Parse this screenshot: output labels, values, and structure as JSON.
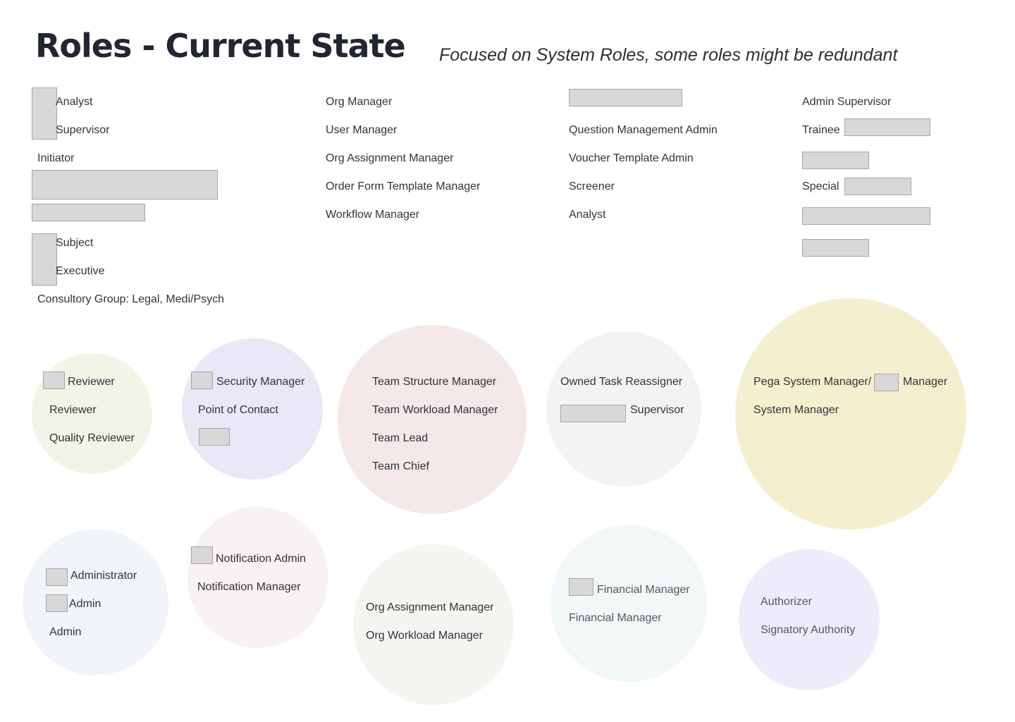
{
  "header": {
    "title": "Roles - Current State",
    "subtitle": "Focused on System Roles, some roles might be redundant"
  },
  "columns": {
    "col1": [
      "Analyst",
      "Supervisor",
      "Initiator",
      "Subject",
      "Executive",
      "Consultory Group: Legal, Medi/Psych"
    ],
    "col2": [
      "Org Manager",
      "User Manager",
      "Org Assignment Manager",
      "Order Form Template Manager",
      "Workflow Manager"
    ],
    "col3": [
      "Question Management Admin",
      "Voucher Template Admin",
      "Screener",
      "Analyst"
    ],
    "col4": [
      "Admin Supervisor",
      "Trainee",
      "Special"
    ]
  },
  "groups": {
    "reviewers": [
      "Reviewer",
      "Reviewer",
      "Quality Reviewer"
    ],
    "security": [
      "Security Manager",
      "Point of Contact"
    ],
    "team": [
      "Team Structure Manager",
      "Team Workload Manager",
      "Team Lead",
      "Team Chief"
    ],
    "tasks": [
      "Owned Task Reassigner",
      "Supervisor"
    ],
    "pega": [
      "Pega System Manager/",
      "Manager",
      "System Manager"
    ],
    "admins": [
      "Administrator",
      "Admin",
      "Admin"
    ],
    "notification": [
      "Notification Admin",
      "Notification Manager"
    ],
    "org": [
      "Org Assignment Manager",
      "Org Workload Manager"
    ],
    "financial": [
      "Financial Manager",
      "Financial Manager"
    ],
    "authority": [
      "Authorizer",
      "Signatory Authority"
    ]
  },
  "colors": {
    "reviewers": "#f3f3e7",
    "security": "#e9e8f6",
    "team": "#f4e8e8",
    "tasks": "#f3f3f3",
    "pega": "#f4f0cf",
    "admins": "#f1f4f8",
    "notification": "#f8f2f4",
    "org": "#f4f6f1",
    "financial": "#f2f8f7",
    "authority": "#efebfa",
    "redaction": "#d8d8d8"
  }
}
